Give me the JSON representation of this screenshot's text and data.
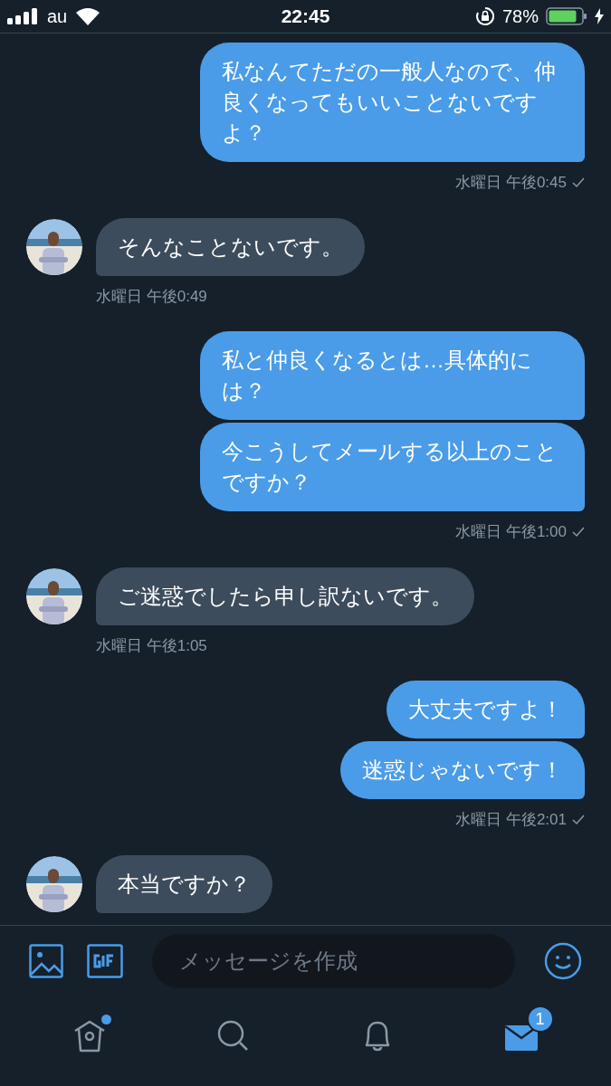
{
  "status_bar": {
    "carrier": "au",
    "time": "22:45",
    "battery": "78%"
  },
  "groups": [
    {
      "kind": "outgoing",
      "messages": [
        "私なんてただの一般人なので、仲良くなってもいいことないですよ？"
      ],
      "timestamp": "水曜日 午後0:45",
      "read": true
    },
    {
      "kind": "incoming",
      "messages": [
        "そんなことないです。"
      ],
      "timestamp": "水曜日 午後0:49"
    },
    {
      "kind": "outgoing",
      "messages": [
        "私と仲良くなるとは…具体的には？",
        "今こうしてメールする以上のことですか？"
      ],
      "timestamp": "水曜日 午後1:00",
      "read": true
    },
    {
      "kind": "incoming",
      "messages": [
        "ご迷惑でしたら申し訳ないです。"
      ],
      "timestamp": "水曜日 午後1:05"
    },
    {
      "kind": "outgoing",
      "messages": [
        "大丈夫ですよ！",
        "迷惑じゃないです！"
      ],
      "timestamp": "水曜日 午後2:01",
      "read": true
    },
    {
      "kind": "incoming",
      "messages": [
        "本当ですか？"
      ]
    }
  ],
  "composer": {
    "placeholder": "メッセージを作成"
  },
  "tabs": [
    {
      "kind": "home",
      "selected": false,
      "dot": true
    },
    {
      "kind": "search",
      "selected": false,
      "dot": false
    },
    {
      "kind": "notifications",
      "selected": false,
      "dot": false
    },
    {
      "kind": "messages",
      "selected": true,
      "dot": false,
      "badge": "1"
    }
  ]
}
